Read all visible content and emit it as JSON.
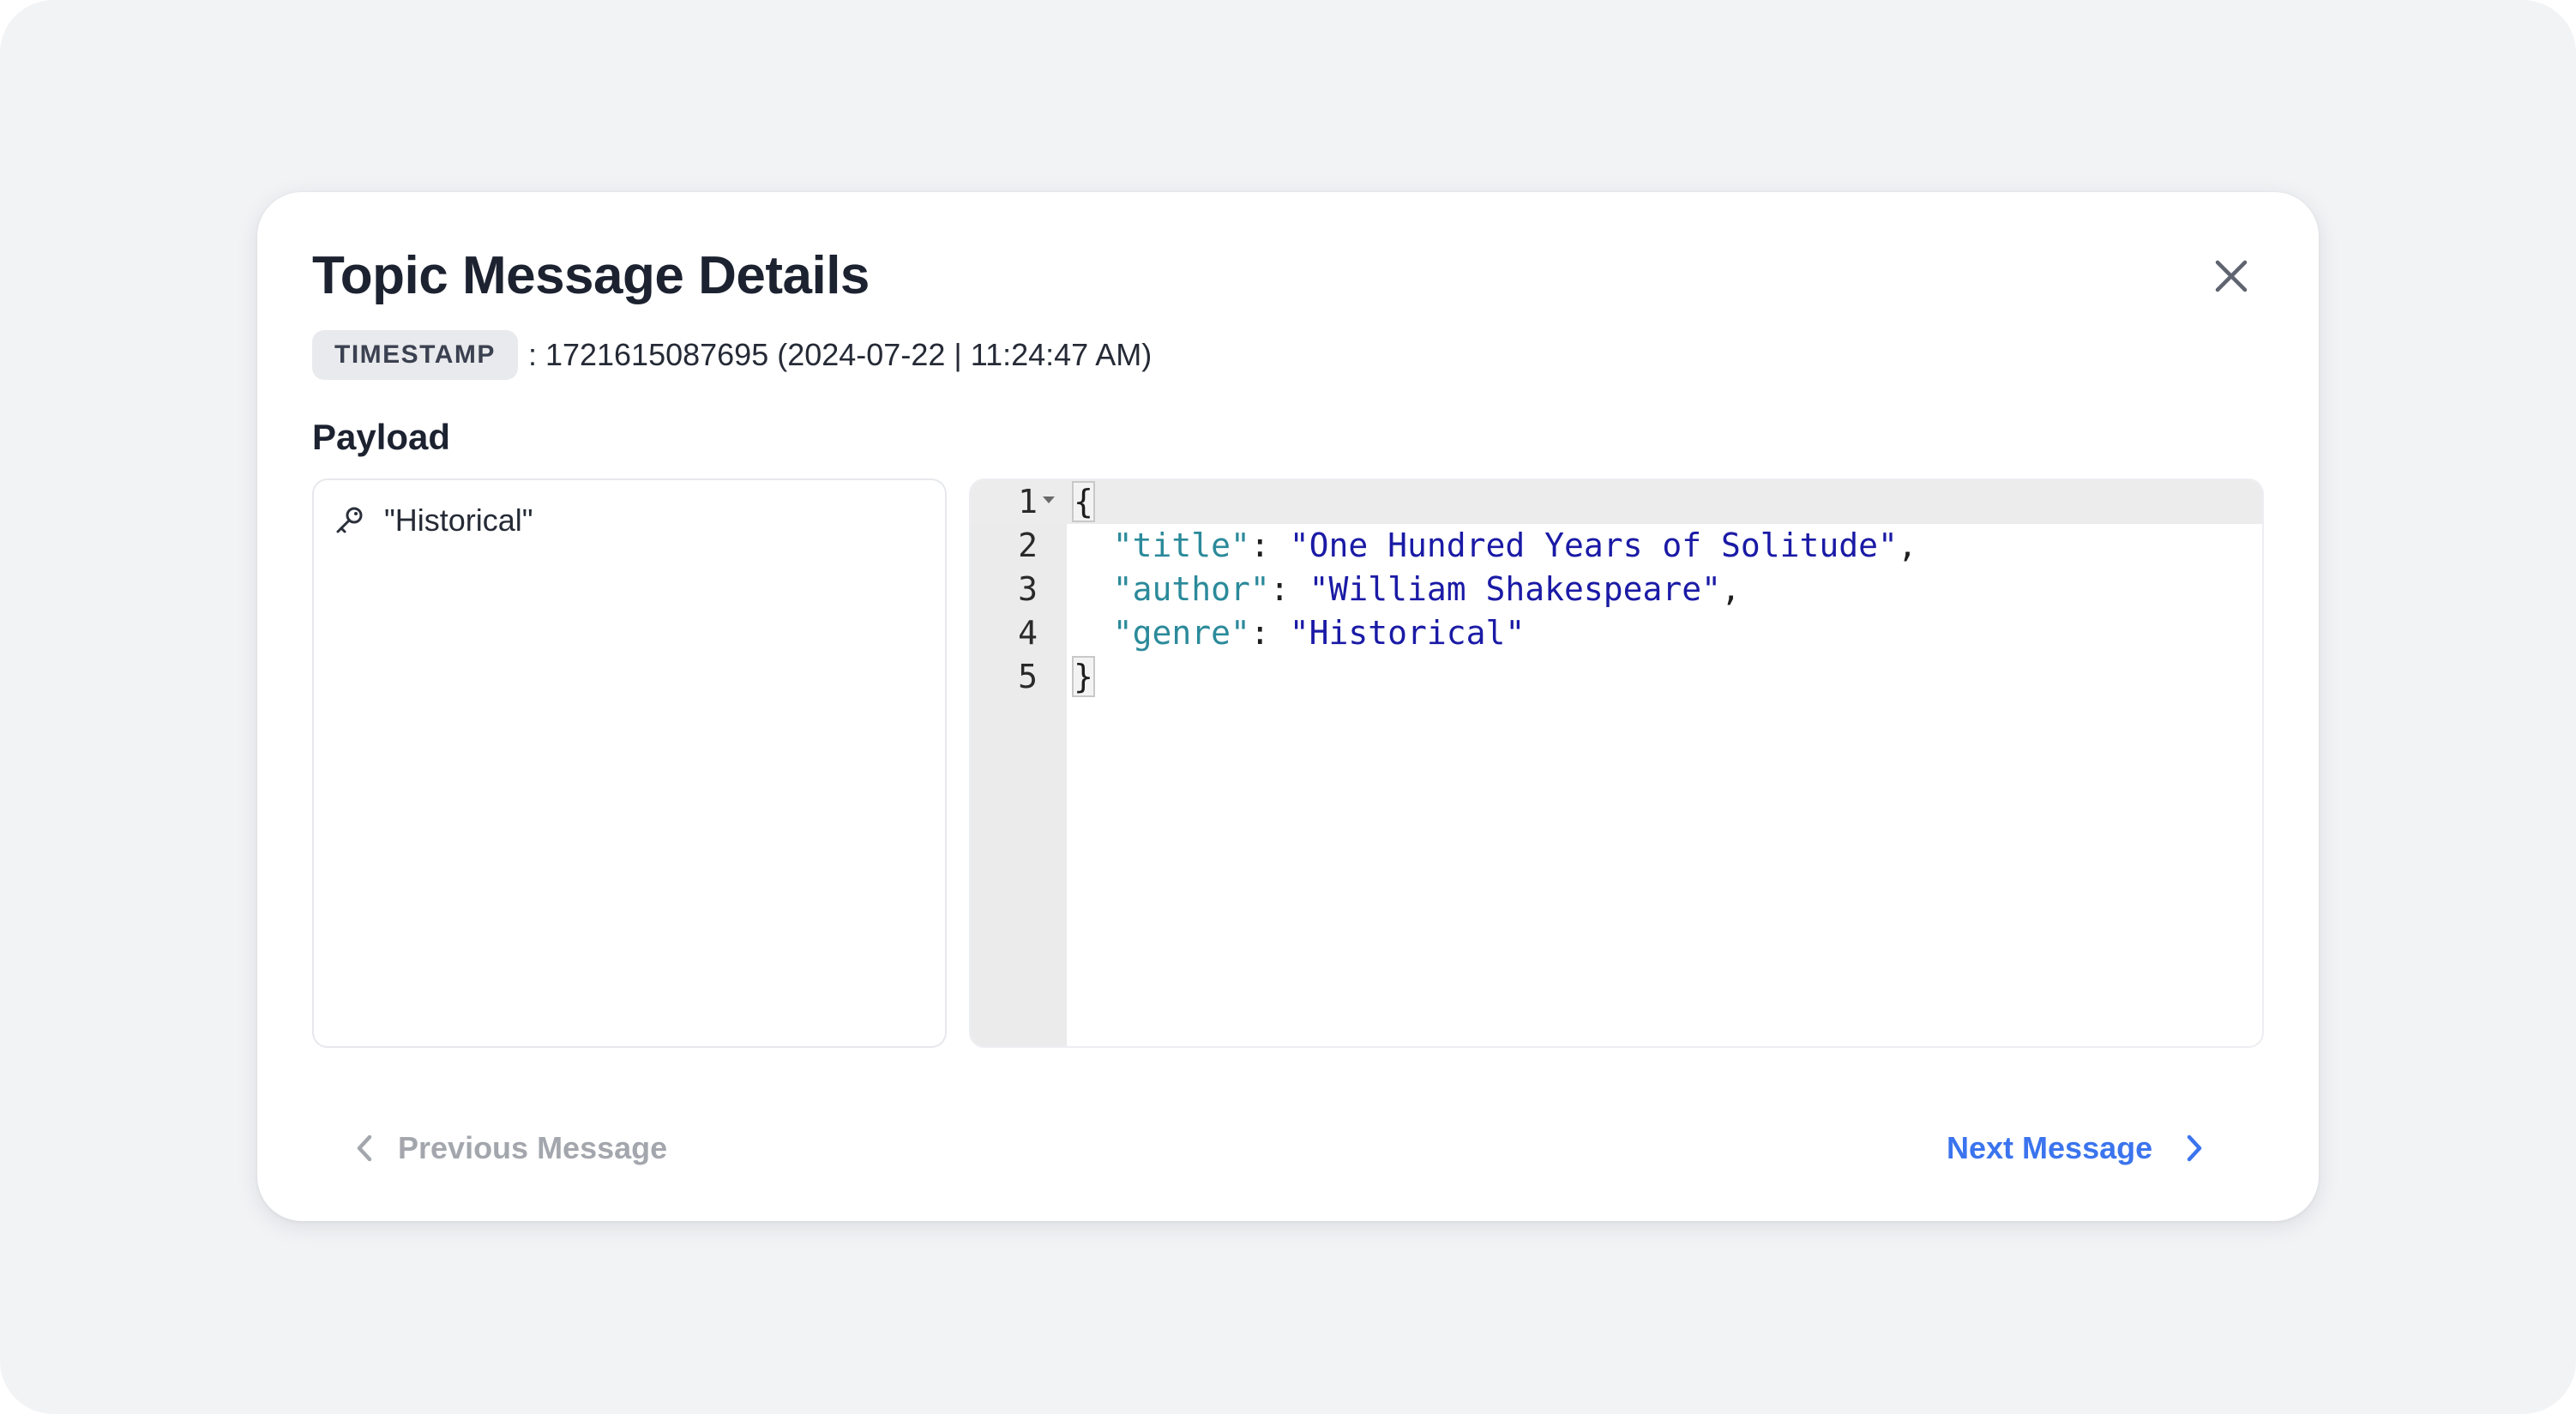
{
  "modal": {
    "title": "Topic Message Details",
    "close_icon": "close-icon"
  },
  "timestamp": {
    "badge": "TIMESTAMP",
    "value": ": 1721615087695 (2024-07-22 | 11:24:47 AM)"
  },
  "payload": {
    "label": "Payload",
    "tree": {
      "items": [
        {
          "icon": "key-icon",
          "label": "\"Historical\""
        }
      ]
    },
    "editor": {
      "line_numbers": [
        "1",
        "2",
        "3",
        "4",
        "5"
      ],
      "lines": [
        {
          "open": "{"
        },
        {
          "key": "\"title\"",
          "sep": ": ",
          "val": "\"One Hundred Years of Solitude\"",
          "end": ","
        },
        {
          "key": "\"author\"",
          "sep": ": ",
          "val": "\"William Shakespeare\"",
          "end": ","
        },
        {
          "key": "\"genre\"",
          "sep": ": ",
          "val": "\"Historical\"",
          "end": ""
        },
        {
          "close": "}"
        }
      ]
    }
  },
  "navigation": {
    "previous_label": "Previous Message",
    "previous_icon": "chevron-left-icon",
    "next_label": "Next Message",
    "next_icon": "chevron-right-icon"
  },
  "colors": {
    "background": "#f2f3f5",
    "accent": "#3b74ee",
    "disabled": "#a3a7ad",
    "json_key": "#2b8a9a",
    "json_string": "#1a1aa6"
  }
}
